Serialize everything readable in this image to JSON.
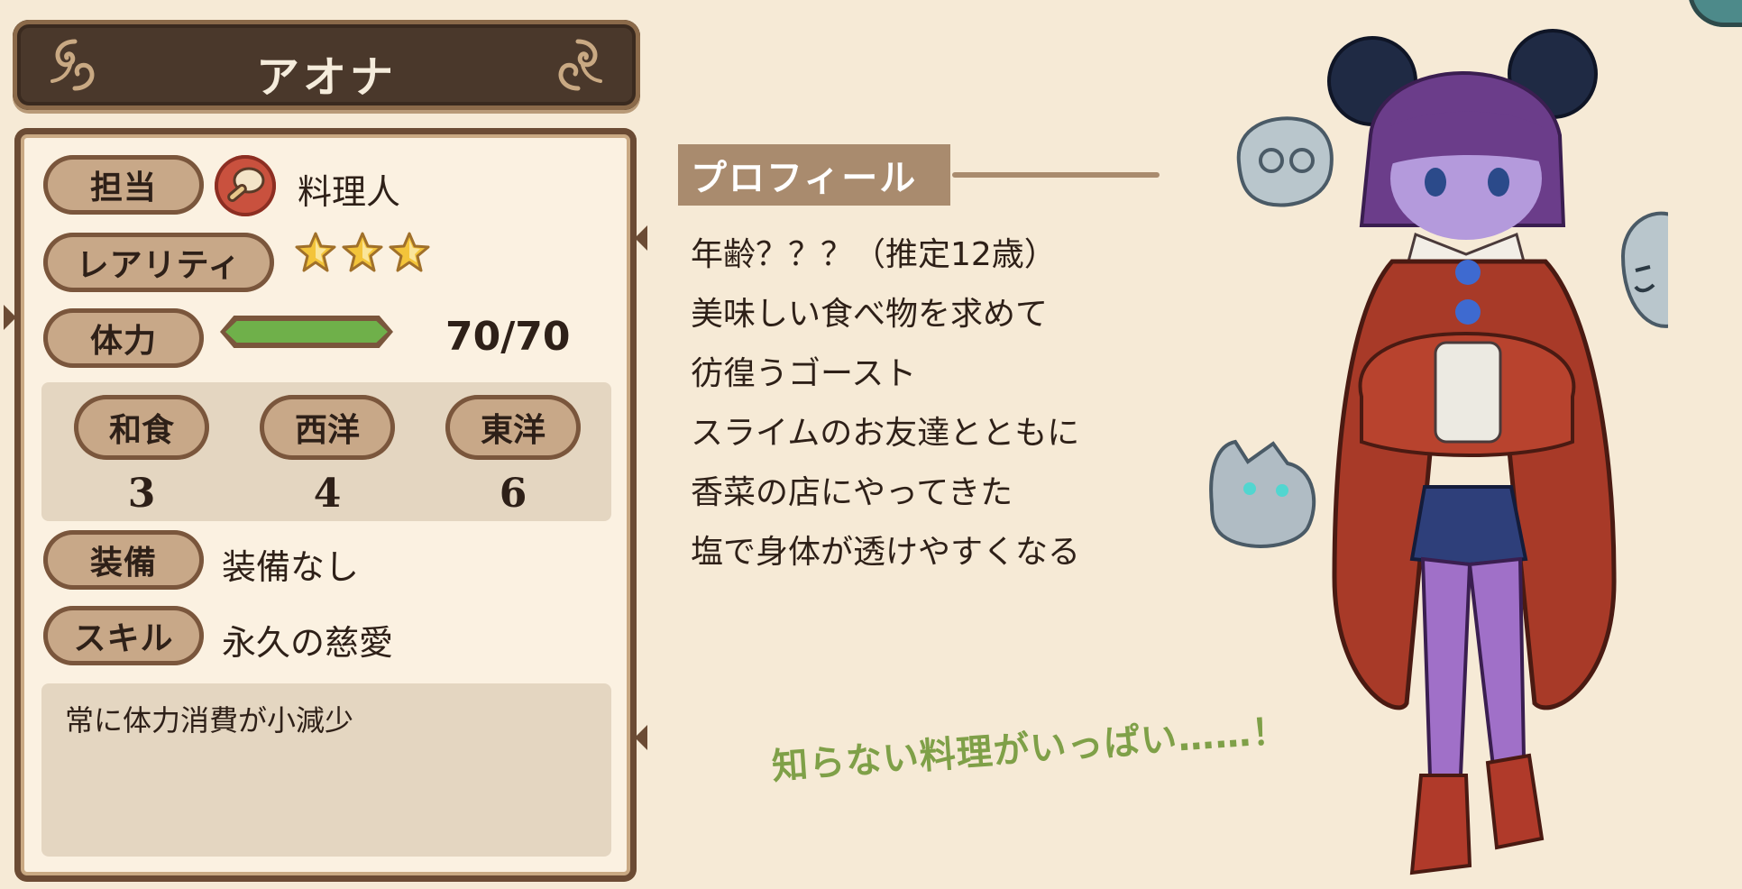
{
  "character": {
    "name": "アオナ"
  },
  "status": {
    "role_label": "担当",
    "role_value": "料理人",
    "rarity_label": "レアリティ",
    "rarity_stars": 3,
    "hp_label": "体力",
    "hp_value": "70/70",
    "hp_fraction": 1.0,
    "cuisines": [
      {
        "label": "和食",
        "value": "3"
      },
      {
        "label": "西洋",
        "value": "4"
      },
      {
        "label": "東洋",
        "value": "6"
      }
    ],
    "equip_label": "装備",
    "equip_value": "装備なし",
    "skill_label": "スキル",
    "skill_value": "永久の慈愛",
    "skill_description": "常に体力消費が小減少"
  },
  "profile": {
    "heading": "プロフィール",
    "lines": [
      "年齢？？？（推定12歳）",
      "美味しい食べ物を求めて",
      "彷徨うゴースト",
      "スライムのお友達とともに",
      "香菜の店にやってきた",
      "塩で身体が透けやすくなる"
    ],
    "catchphrase": "知らない料理がいっぱい……！"
  },
  "icons": {
    "role_icon": "frying-pan-icon",
    "rarity_icon": "star-icon",
    "ornament_icon": "scroll-ornament-icon"
  },
  "colors": {
    "background": "#f6ead6",
    "banner": "#4a382b",
    "label_fill": "#c8a888",
    "label_border": "#7a563c",
    "hp_green": "#6fb04a",
    "profile_head": "#a98b6e",
    "catch_green": "#7fa048",
    "star_gold": "#f3c43a"
  }
}
